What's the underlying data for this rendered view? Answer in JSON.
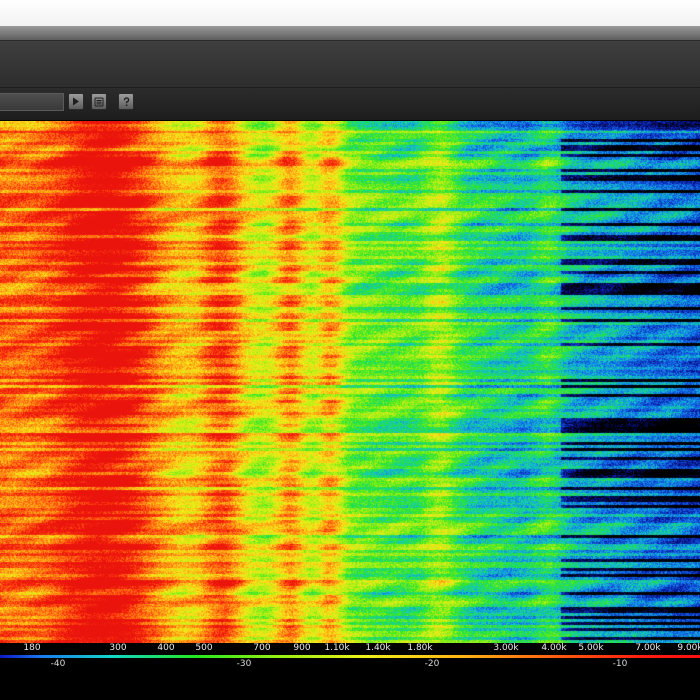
{
  "toolbar": {
    "play_icon": "play-icon",
    "list_icon": "list-icon",
    "help_icon": "help-icon"
  },
  "spectrum": {
    "frequency_ticks": [
      "180",
      "300",
      "400",
      "500",
      "700",
      "900",
      "1.10k",
      "1.40k",
      "1.80k",
      "3.00k",
      "4.00k",
      "5.00k",
      "7.00k",
      "9.00k"
    ],
    "level_ticks": [
      "-40",
      "-30",
      "-20",
      "-10"
    ],
    "colors": {
      "low": "#0a1cc8",
      "mid": "#20e020",
      "high": "#ffd020",
      "peak": "#ff1a10"
    }
  }
}
